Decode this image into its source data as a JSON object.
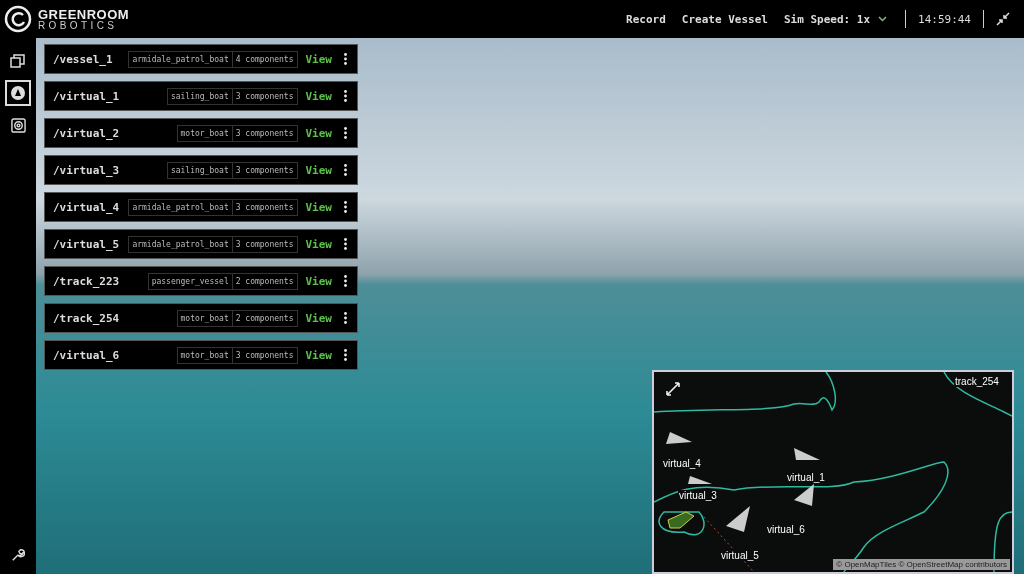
{
  "brand": {
    "name": "GREENROOM",
    "sub": "ROBOTICS"
  },
  "header": {
    "actions": [
      "Record",
      "Create Vessel"
    ],
    "sim_speed": "Sim Speed: 1x",
    "clock": "14:59:44"
  },
  "sidebar": {
    "items": [
      {
        "kind": "copies",
        "selected": false
      },
      {
        "kind": "compass",
        "selected": true
      },
      {
        "kind": "target",
        "selected": false
      }
    ],
    "bottom": {
      "kind": "wrench"
    }
  },
  "vessels": [
    {
      "name": "/vessel_1",
      "type": "armidale_patrol_boat",
      "components": "4 components",
      "action": "View"
    },
    {
      "name": "/virtual_1",
      "type": "sailing_boat",
      "components": "3 components",
      "action": "View"
    },
    {
      "name": "/virtual_2",
      "type": "motor_boat",
      "components": "3 components",
      "action": "View"
    },
    {
      "name": "/virtual_3",
      "type": "sailing_boat",
      "components": "3 components",
      "action": "View"
    },
    {
      "name": "/virtual_4",
      "type": "armidale_patrol_boat",
      "components": "3 components",
      "action": "View"
    },
    {
      "name": "/virtual_5",
      "type": "armidale_patrol_boat",
      "components": "3 components",
      "action": "View"
    },
    {
      "name": "/track_223",
      "type": "passenger_vessel",
      "components": "2 components",
      "action": "View"
    },
    {
      "name": "/track_254",
      "type": "motor_boat",
      "components": "2 components",
      "action": "View"
    },
    {
      "name": "/virtual_6",
      "type": "motor_boat",
      "components": "3 components",
      "action": "View"
    }
  ],
  "minimap": {
    "labels": [
      "track_254",
      "virtual_4",
      "virtual_1",
      "virtual_3",
      "virtual_6",
      "virtual_5"
    ],
    "attribution": "© OpenMapTiles © OpenStreetMap contributors"
  }
}
